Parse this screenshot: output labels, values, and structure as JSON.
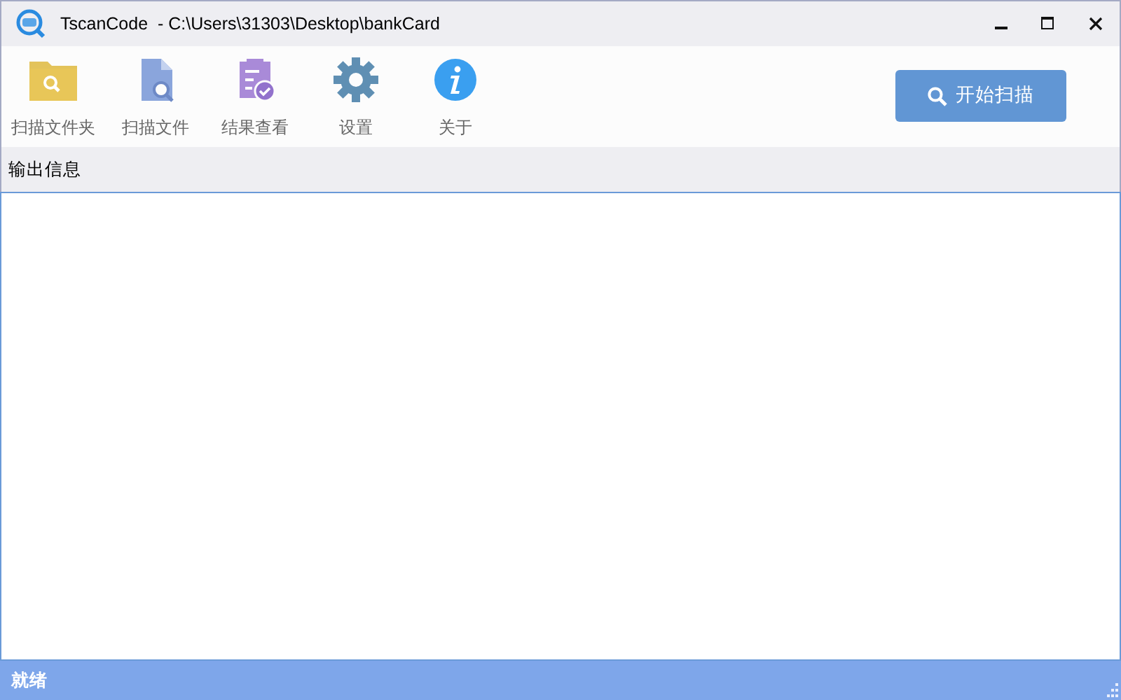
{
  "window": {
    "title": "TscanCode  - C:\\Users\\31303\\Desktop\\bankCard"
  },
  "toolbar": [
    {
      "kind": "folder",
      "label": "扫描文件夹"
    },
    {
      "kind": "file",
      "label": "扫描文件"
    },
    {
      "kind": "result",
      "label": "结果查看"
    },
    {
      "kind": "settings",
      "label": "设置"
    },
    {
      "kind": "about",
      "label": "关于"
    }
  ],
  "scan_button": {
    "label": "开始扫描"
  },
  "output": {
    "title": "输出信息"
  },
  "status_bar": {
    "text": "就绪"
  }
}
